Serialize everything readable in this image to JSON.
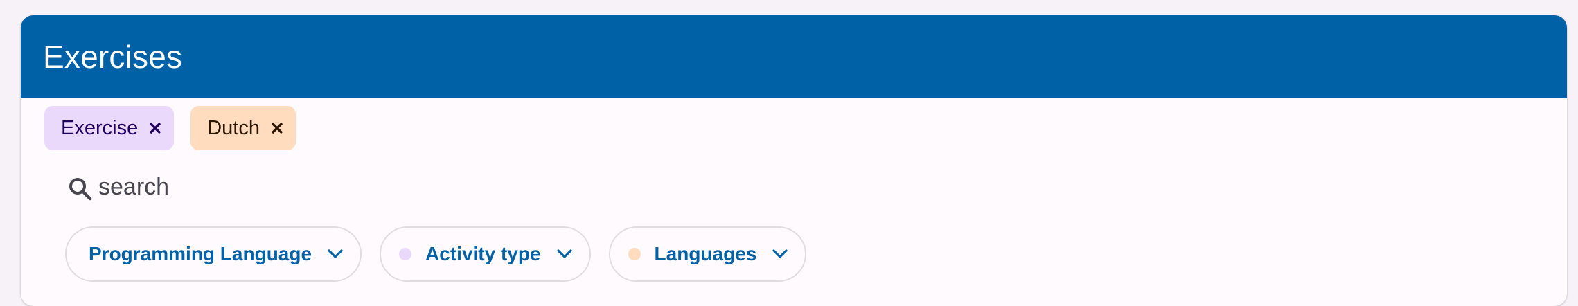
{
  "header": {
    "title": "Exercises"
  },
  "active_filters": [
    {
      "label": "Exercise",
      "color": "#ead9fb"
    },
    {
      "label": "Dutch",
      "color": "#ffdcbd"
    }
  ],
  "search": {
    "placeholder": "search",
    "value": ""
  },
  "filter_buttons": [
    {
      "label": "Programming Language",
      "dot_color": null
    },
    {
      "label": "Activity type",
      "dot_color": "#ead9fb"
    },
    {
      "label": "Languages",
      "dot_color": "#ffdcbd"
    }
  ],
  "colors": {
    "brand": "#0061a6",
    "surface": "#fefafe",
    "background": "#f7f2f7"
  },
  "icons": {
    "chip_remove": "close-icon",
    "search": "search-icon",
    "dropdown": "chevron-down-icon"
  }
}
